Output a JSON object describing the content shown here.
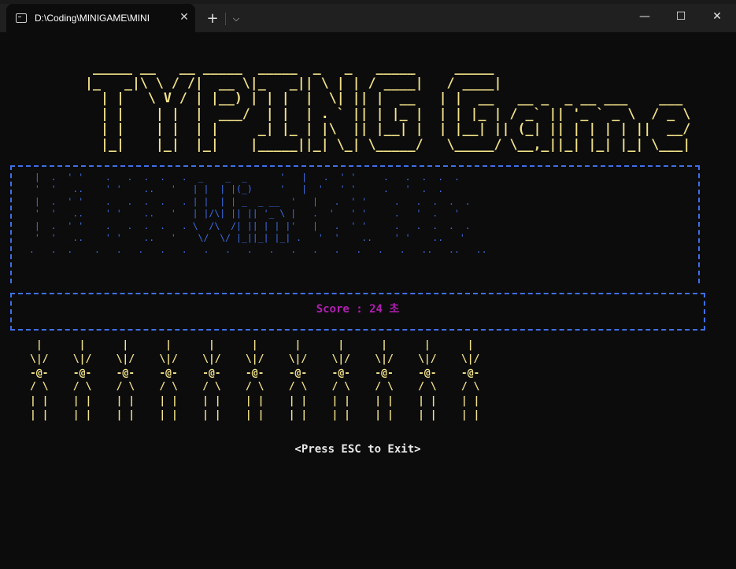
{
  "window": {
    "tab_title": "D:\\Coding\\MINIGAME\\MINI",
    "tab_close": "✕",
    "new_tab": "+",
    "tab_dropdown": "⌵",
    "minimize": "—",
    "maximize": "☐",
    "close": "✕"
  },
  "terminal": {
    "logo_art": " _____ __   __ _____  _____  _   _   _____     _____\n|_   _|\\ \\ / /|  __ \\|_   _|| \\ | | / ____|   / ____|\n  | |   \\ V / | |__) | | |  |  \\| || |  __   | |  __   __ _  _ __ ___    ___\n  | |    | |  |  ___/  | |  | . ` || | |_ |  | | |_ | / _` || '_ ` _ \\  / _ \\\n  | |    | |  | |     _| |_ | |\\  || |__| |  | |__| || (_| || | | | | ||  __/\n  |_|    |_|  |_|    |_____||_| \\_| \\_____/   \\_____/ \\__,_||_| |_| |_| \\___|",
    "rain_art": "  |  .  ' '    .   .  .  .   .  _    _  _      '   |   .  ' '     .   .  .  .  .\n  '  '   ..    ' '    ..   '   | |  | |(_)     '   |  '   ' '     .   '  .  .\n  |  .  ' '    .   .  .  .   . | |  | | _  _ __  '   |   .  ' '     .   .  .  .  .\n  '  '   ..    ' '    ..   '   | |/\\| || || '_ \\ |   .  '   ' '     .   '  .   '\n  |  .  ' '    .   .  .  .   . \\  /\\  /| || | | |'   |   .  ' '     .   .  .  .  .\n  '  '   ..    ' '    ..   '    \\/  \\/ |_||_| |_| .   '  '    ..    ' '    ..   '\n .   .  .    .   .   .   .   .   .   .   .   .   .   .   .   .   .   .   ..   ..   ..",
    "score_text": "Score : 24 초",
    "characters_art": " |      |      |      |      |      |      |      |      |      |      |\n\\|/    \\|/    \\|/    \\|/    \\|/    \\|/    \\|/    \\|/    \\|/    \\|/    \\|/\n-@-    -@-    -@-    -@-    -@-    -@-    -@-    -@-    -@-    -@-    -@-\n/ \\    / \\    / \\    / \\    / \\    / \\    / \\    / \\    / \\    / \\    / \\\n| |    | |    | |    | |    | |    | |    | |    | |    | |    | |    | |\n| |    | |    | |    | |    | |    | |    | |    | |    | |    | |    | |",
    "exit_hint": "<Press ESC to Exit>"
  },
  "colors": {
    "logo": "#f2e28a",
    "rain": "#3f6fe8",
    "score": "#b01fb0",
    "characters": "#f2e28a",
    "background": "#0c0c0c"
  }
}
